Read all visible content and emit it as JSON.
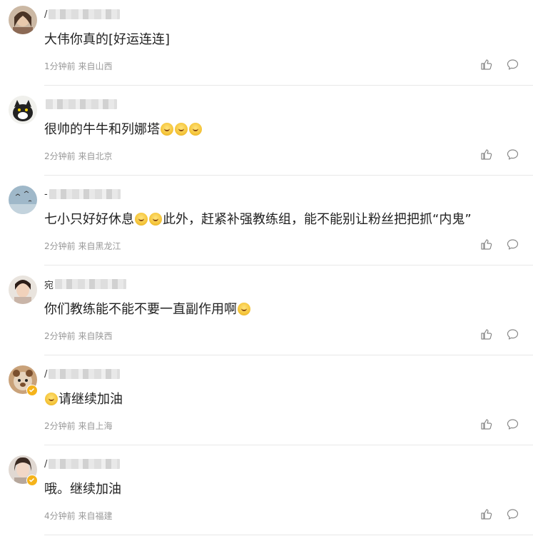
{
  "comments": [
    {
      "name_initial": "/",
      "content": "大伟你真的[好运连连]",
      "emojis_after": 0,
      "time": "1分钟前",
      "location": "来自山西",
      "verified": false,
      "avatar": "woman-portrait"
    },
    {
      "name_initial": "",
      "content": "很帅的牛牛和列娜塔",
      "emojis_after": 3,
      "time": "2分钟前",
      "location": "来自北京",
      "verified": false,
      "avatar": "cat-icon"
    },
    {
      "name_initial": "-",
      "content_a": "七小只好好休息",
      "emojis_mid": 2,
      "content_b": "此外，赶紧补强教练组，能不能别让粉丝把把抓“内鬼”",
      "time": "2分钟前",
      "location": "来自黑龙江",
      "verified": false,
      "avatar": "sky-birds"
    },
    {
      "name_initial": "宛",
      "content": "你们教练能不能不要一直副作用啊",
      "emojis_after": 1,
      "time": "2分钟前",
      "location": "来自陕西",
      "verified": false,
      "avatar": "girl-portrait"
    },
    {
      "name_initial": "/",
      "content": "请继续加油",
      "emojis_before": 1,
      "time": "2分钟前",
      "location": "来自上海",
      "verified": true,
      "avatar": "bear-toy"
    },
    {
      "name_initial": "/",
      "content": "哦。继续加油",
      "emojis_after": 0,
      "time": "4分钟前",
      "location": "来自福建",
      "verified": true,
      "avatar": "woman-portrait-2"
    }
  ],
  "icons": {
    "like": "thumbs-up-icon",
    "reply": "comment-bubble-icon"
  },
  "colors": {
    "meta": "#999999",
    "divider": "#e8e8e8",
    "badge": "#f5b31a"
  }
}
